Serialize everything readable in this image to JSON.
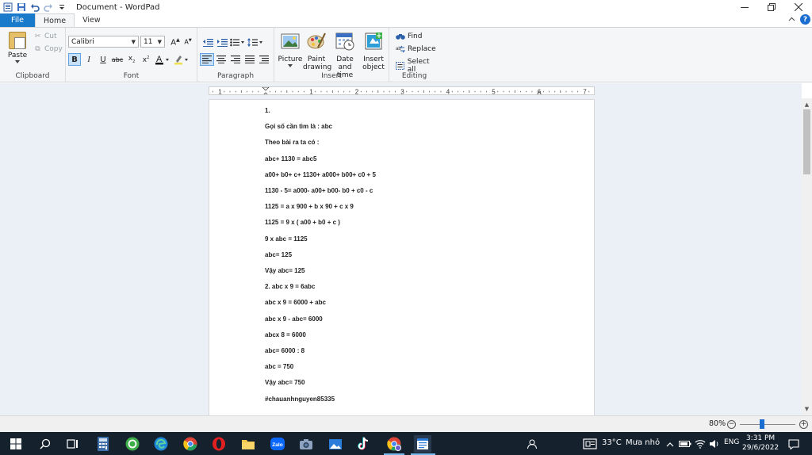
{
  "window": {
    "title": "Document - WordPad"
  },
  "tabs": {
    "file": "File",
    "home": "Home",
    "view": "View"
  },
  "clipboard": {
    "paste": "Paste",
    "cut": "Cut",
    "copy": "Copy",
    "label": "Clipboard"
  },
  "font": {
    "family": "Calibri",
    "size": "11",
    "label": "Font"
  },
  "paragraph": {
    "label": "Paragraph"
  },
  "insert": {
    "picture": "Picture",
    "paint_drawing_1": "Paint",
    "paint_drawing_2": "drawing",
    "date_time_1": "Date and",
    "date_time_2": "time",
    "insert_object_1": "Insert",
    "insert_object_2": "object",
    "label": "Insert"
  },
  "editing": {
    "find": "Find",
    "replace": "Replace",
    "select_all": "Select all",
    "label": "Editing"
  },
  "ruler": {
    "numbers": [
      "1",
      "1",
      "2",
      "3",
      "4",
      "5",
      "6",
      "7"
    ]
  },
  "document": {
    "lines": [
      "1.",
      "Gọi số cần tìm là : abc",
      "Theo bài ra ta có :",
      "abc+ 1130 = abc5",
      "a00+ b0+ c+ 1130+ a000+ b00+ c0 + 5",
      "1130 - 5= a000- a00+ b00- b0 + c0 - c",
      "1125 = a x 900 + b x 90 + c x 9",
      "1125 = 9 x ( a00 + b0 + c )",
      "9 x abc = 1125",
      "abc= 125",
      "Vậy abc= 125",
      "2. abc x 9 = 6abc",
      "abc x 9 = 6000 + abc",
      "abc x 9 - abc= 6000",
      "abcx 8 = 6000",
      "abc= 6000 : 8",
      "abc = 750",
      "Vậy abc= 750",
      "#chauanhnguyen85335"
    ]
  },
  "status": {
    "zoom": "80%"
  },
  "taskbar": {
    "temperature": "33°C",
    "weather": "Mưa nhỏ",
    "language": "ENG",
    "time": "3:31 PM",
    "date": "29/6/2022"
  }
}
